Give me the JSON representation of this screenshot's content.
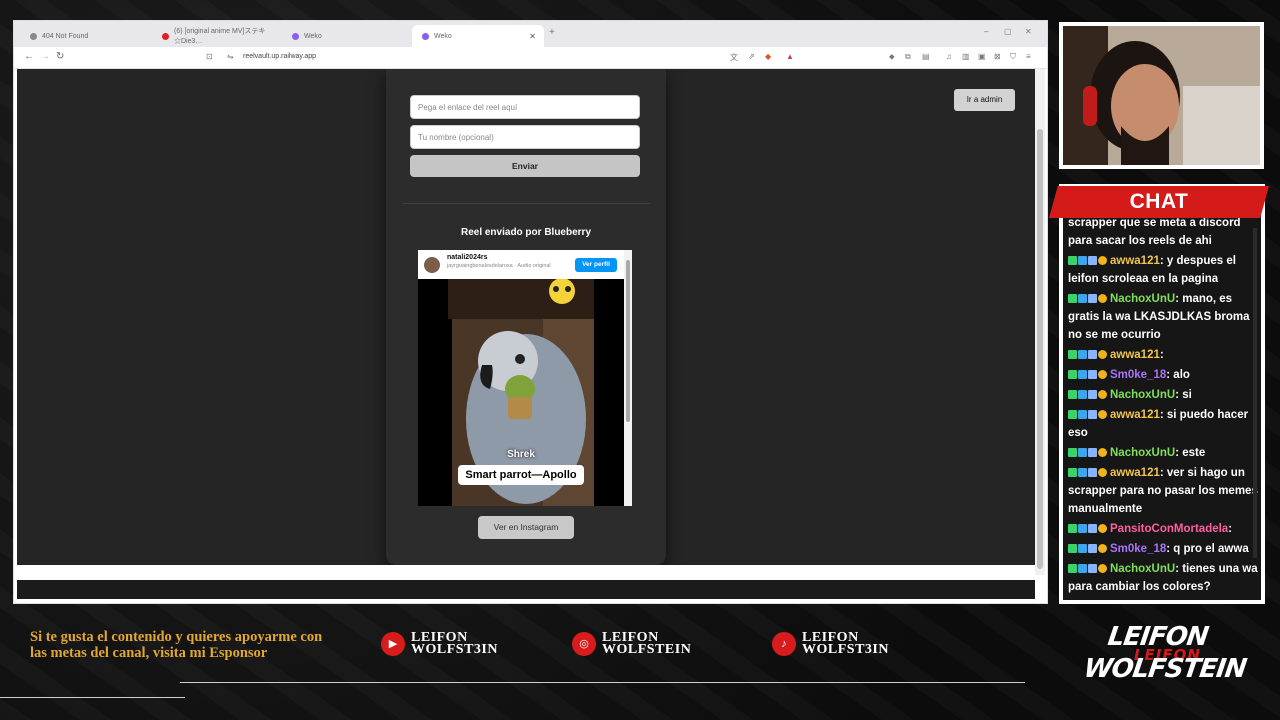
{
  "browser": {
    "tabs": [
      {
        "title": "404 Not Found",
        "active": false
      },
      {
        "title": "(6) [original anime MV]ステキ☆Die3…",
        "active": false
      },
      {
        "title": "Weko",
        "active": false
      },
      {
        "title": "Weko",
        "active": true
      }
    ],
    "url": "reelvault.up.railway.app",
    "window_controls": [
      "–",
      "▢",
      "✕"
    ]
  },
  "page": {
    "link_placeholder": "Pega el enlace del reel aquí",
    "name_placeholder": "Tu nombre (opcional)",
    "submit_label": "Enviar",
    "reel_title": "Reel enviado por Blueberry",
    "ver_instagram_label": "Ver en Instagram",
    "admin_label": "Ir a admin"
  },
  "embed": {
    "username": "natali2024rs",
    "subtitle": "jayrguaingbenalesdelarosa · Audio original",
    "ver_perfil": "Ver perfil",
    "video_label": "Shrek",
    "video_caption": "Smart parrot—Apollo"
  },
  "chat": {
    "title": "CHAT",
    "messages": [
      {
        "user": "",
        "text": "scrapper que se meta a discord para sacar los reels de ahi",
        "color": "#ffffff"
      },
      {
        "user": "awwa121",
        "text": ": y despues el leifon scroleaa en la pagina",
        "color": "#f2c64d"
      },
      {
        "user": "NachoxUnU",
        "text": ": mano, es gratis la wa LKASJDLKAS broma no se me ocurrio",
        "color": "#7fe05a"
      },
      {
        "user": "awwa121",
        "text": ": ",
        "color": "#f2c64d"
      },
      {
        "user": "Sm0ke_18",
        "text": ": alo",
        "color": "#a974f5"
      },
      {
        "user": "NachoxUnU",
        "text": ": si",
        "color": "#7fe05a"
      },
      {
        "user": "awwa121",
        "text": ": si puedo hacer eso",
        "color": "#f2c64d"
      },
      {
        "user": "NachoxUnU",
        "text": ": este",
        "color": "#7fe05a"
      },
      {
        "user": "awwa121",
        "text": ": ver si hago un scrapper para no pasar los memes manualmente",
        "color": "#f2c64d"
      },
      {
        "user": "PansitoConMortadela",
        "text": ": ",
        "color": "#ff5fa2"
      },
      {
        "user": "Sm0ke_18",
        "text": ": q pro el awwa",
        "color": "#a974f5"
      },
      {
        "user": "NachoxUnU",
        "text": ": tienes una wa para cambiar los colores?",
        "color": "#7fe05a"
      }
    ]
  },
  "overlay": {
    "promo": "Si te gusta el contenido y quieres apoyarme con las metas del canal, visita mi Esponsor",
    "socials": [
      {
        "platform": "youtube",
        "line1": "LEIFON",
        "line2": "WOLFST3IN",
        "icon": "▶"
      },
      {
        "platform": "instagram",
        "line1": "LEIFON",
        "line2": "WOLFSTEIN",
        "icon": "◎"
      },
      {
        "platform": "tiktok",
        "line1": "LEIFON",
        "line2": "WOLFST3IN",
        "icon": "♪"
      }
    ],
    "logo_line1": "LEIFON",
    "logo_line2": "WOLFSTEIN",
    "logo_red": "LEIFON",
    "accent": "#d51a1a",
    "promo_color": "#e1a733"
  }
}
